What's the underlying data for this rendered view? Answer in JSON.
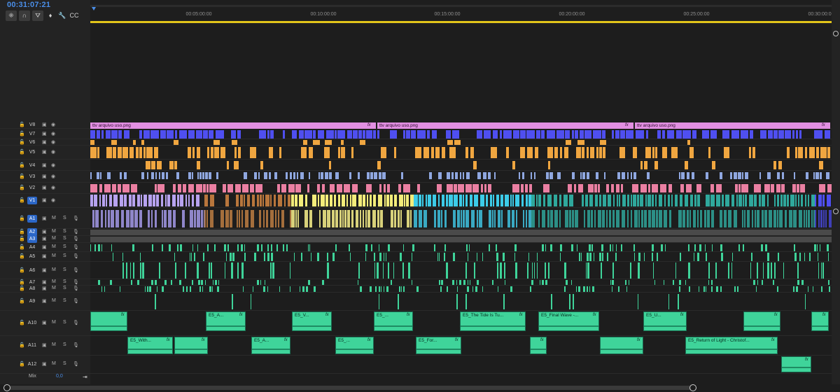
{
  "timecode": "00:31:07:21",
  "toolbar": [
    {
      "name": "snap-tool-button",
      "glyph": "⁜"
    },
    {
      "name": "linked-selection-button",
      "glyph": "∩"
    },
    {
      "name": "add-marker-button",
      "glyph": "⛛"
    },
    {
      "name": "marker-icon",
      "glyph": "♦"
    },
    {
      "name": "wrench-icon",
      "glyph": "🔧"
    },
    {
      "name": "captions-icon",
      "glyph": "CC"
    }
  ],
  "ruler": {
    "labels": [
      "00:05:00:00",
      "00:10:00:00",
      "00:15:00:00",
      "00:20:00:00",
      "00:25:00:00",
      "00:30:00:00"
    ]
  },
  "mix": {
    "label": "Mix",
    "value": "0,0"
  },
  "tracks": [
    {
      "id": "V8",
      "kind": "video",
      "selected": false
    },
    {
      "id": "V7",
      "kind": "video",
      "selected": false
    },
    {
      "id": "V6",
      "kind": "video",
      "selected": false
    },
    {
      "id": "V5",
      "kind": "video",
      "selected": false
    },
    {
      "id": "V4",
      "kind": "video",
      "selected": false
    },
    {
      "id": "V3",
      "kind": "video",
      "selected": false
    },
    {
      "id": "V2",
      "kind": "video",
      "selected": false
    },
    {
      "id": "V1",
      "kind": "video",
      "selected": true
    },
    {
      "id": "A1",
      "kind": "audio",
      "selected": true
    },
    {
      "id": "A2",
      "kind": "audio",
      "selected": true
    },
    {
      "id": "A3",
      "kind": "audio",
      "selected": true
    },
    {
      "id": "A4",
      "kind": "audio",
      "selected": false
    },
    {
      "id": "A5",
      "kind": "audio",
      "selected": false
    },
    {
      "id": "A6",
      "kind": "audio",
      "selected": false
    },
    {
      "id": "A7",
      "kind": "audio",
      "selected": false
    },
    {
      "id": "A8",
      "kind": "audio",
      "selected": false
    },
    {
      "id": "A9",
      "kind": "audio",
      "selected": false
    },
    {
      "id": "A10",
      "kind": "audio",
      "selected": false
    },
    {
      "id": "A11",
      "kind": "audio",
      "selected": false
    },
    {
      "id": "A12",
      "kind": "audio",
      "selected": false
    }
  ],
  "track_buttons": {
    "mute": "M",
    "solo": "S"
  },
  "v8_clips": [
    "ttv arquivo uso.png",
    "ttv arquivo uso.png",
    "ttv arquivo uso.png"
  ],
  "a10_clips": [
    "E5_A...",
    "E5_V...",
    "E5_...",
    "E5_The Tide Is Tu...",
    "E5_Final Wave -...",
    "E5_U..."
  ],
  "a11_clips": [
    "E5_With...",
    "E5_A...",
    "E5_...",
    "E5_For...",
    "E5_Return of Light - Christof..."
  ],
  "fx_label": "fx",
  "colors": {
    "accent": "#2c67c7",
    "timecode": "#4a8ee8",
    "playhead_bar": "#e2c51a",
    "pink": "#e28fe2",
    "blue": "#4f4ff0",
    "orange": "#f0a640",
    "green": "#3fd49a",
    "lavender": "#b7a3f0",
    "brown": "#b8763c",
    "yellow": "#f3ec7a",
    "cyan": "#3ccbe8",
    "teal": "#2fa89c",
    "salmon": "#ea7fa2"
  }
}
